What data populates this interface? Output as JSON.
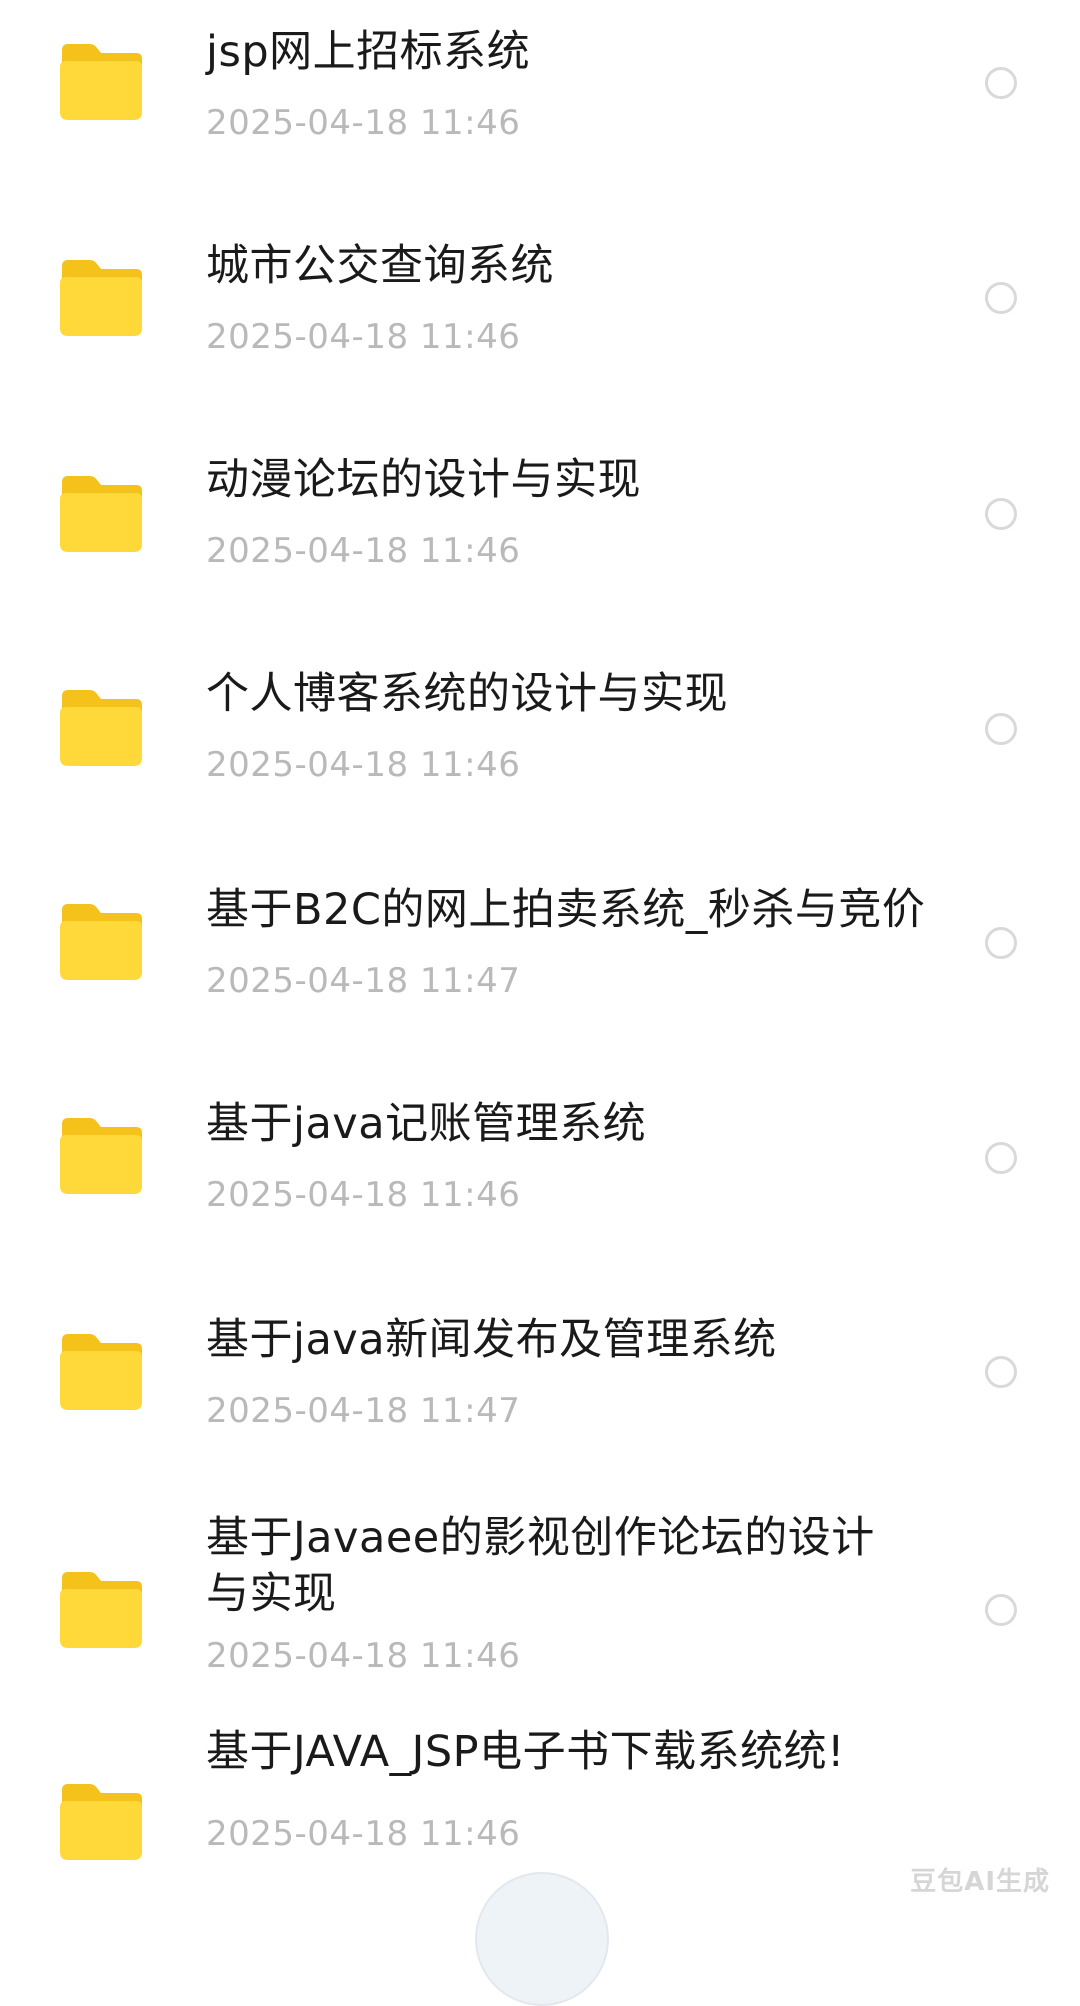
{
  "colors": {
    "folder_front": "#FFD83A",
    "folder_back": "#F5C21B",
    "date_text": "#B9B9B9",
    "radio_border": "#D9D9D9"
  },
  "items": [
    {
      "name": "jsp网上招标系统",
      "date": "2025-04-18  11:46"
    },
    {
      "name": "城市公交查询系统",
      "date": "2025-04-18  11:46"
    },
    {
      "name": "动漫论坛的设计与实现",
      "date": "2025-04-18  11:46"
    },
    {
      "name": "个人博客系统的设计与实现",
      "date": "2025-04-18  11:46"
    },
    {
      "name": "基于B2C的网上拍卖系统_秒杀与竞价",
      "date": "2025-04-18  11:47"
    },
    {
      "name": "基于java记账管理系统",
      "date": "2025-04-18  11:46"
    },
    {
      "name": "基于java新闻发布及管理系统",
      "date": "2025-04-18  11:47"
    },
    {
      "name": "基于Javaee的影视创作论坛的设计与实现",
      "date": "2025-04-18  11:46"
    },
    {
      "name": "基于JAVA_JSP电子书下载系统统!",
      "date": "2025-04-18  11:46"
    }
  ],
  "watermark": "豆包AI生成",
  "icons": {
    "folder": "folder-icon",
    "select": "radio-unchecked-icon"
  }
}
